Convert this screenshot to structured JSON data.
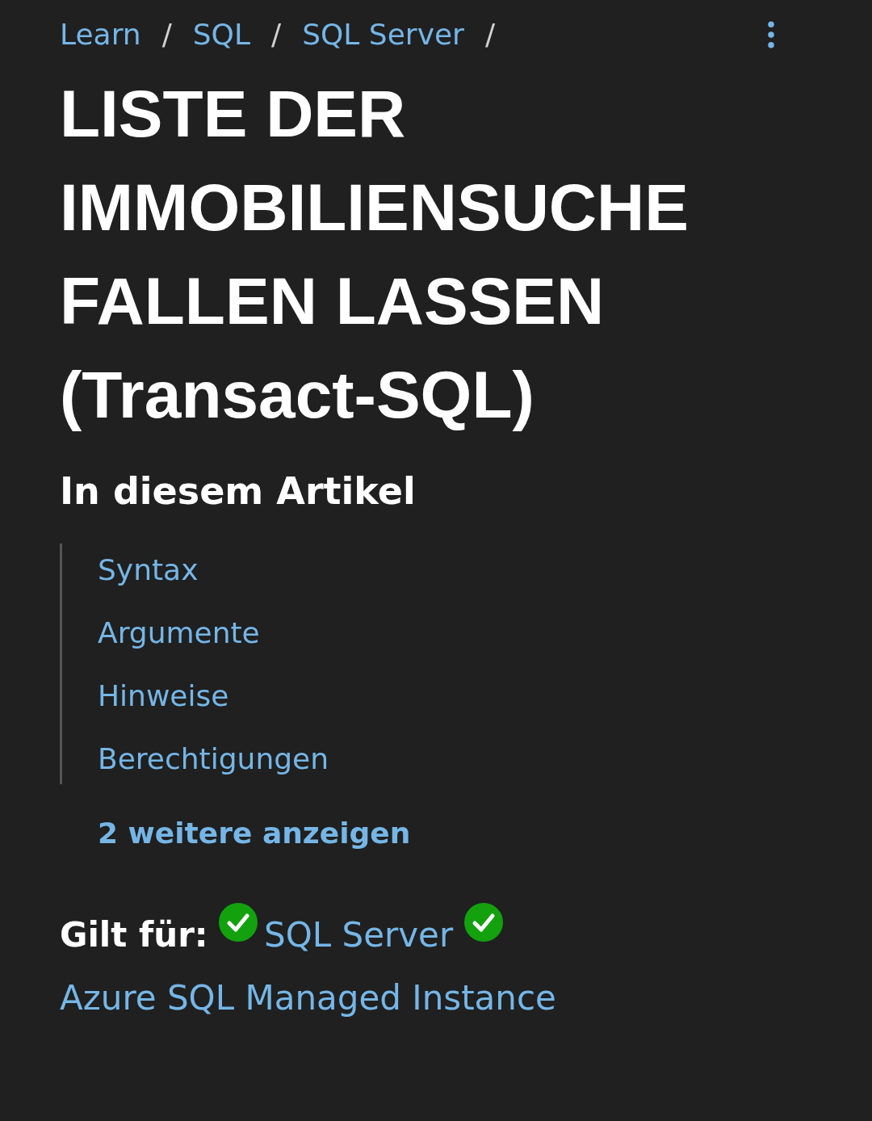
{
  "breadcrumbs": [
    {
      "label": "Learn"
    },
    {
      "label": "SQL"
    },
    {
      "label": "SQL Server"
    }
  ],
  "breadcrumb_separator": "/",
  "title": "LISTE DER IMMOBILIENSUCHE FALLEN LASSEN (Transact-SQL)",
  "toc": {
    "heading": "In diesem Artikel",
    "items": [
      {
        "label": "Syntax"
      },
      {
        "label": "Argumente"
      },
      {
        "label": "Hinweise"
      },
      {
        "label": "Berechtigungen"
      }
    ],
    "show_more": "2 weitere anzeigen"
  },
  "applies_to": {
    "label": "Gilt für:",
    "products": [
      {
        "label": "SQL Server"
      },
      {
        "label": "Azure SQL Managed Instance"
      }
    ]
  }
}
